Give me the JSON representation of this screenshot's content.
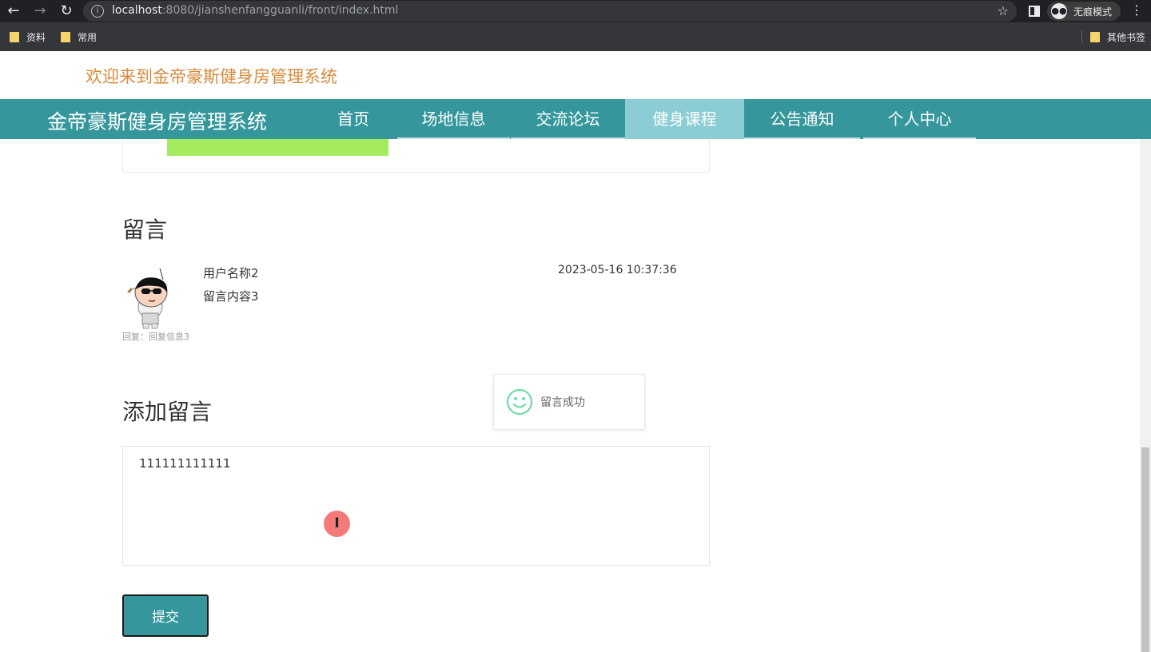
{
  "browser": {
    "back_icon": "arrow-left-icon",
    "forward_icon": "arrow-right-icon",
    "reload_icon": "reload-icon",
    "url_host": "localhost",
    "url_rest": ":8080/jianshenfangguanli/front/index.html",
    "incognito_label": "无痕模式",
    "bookmarks": [
      "资料",
      "常用"
    ],
    "other_bookmarks": "其他书签"
  },
  "header": {
    "welcome": "欢迎来到金帝豪斯健身房管理系统",
    "site_title": "金帝豪斯健身房管理系统"
  },
  "nav": {
    "items": [
      {
        "label": "首页",
        "active": false
      },
      {
        "label": "场地信息",
        "active": false
      },
      {
        "label": "交流论坛",
        "active": false
      },
      {
        "label": "健身课程",
        "active": true
      },
      {
        "label": "公告通知",
        "active": false
      },
      {
        "label": "个人中心",
        "active": false
      }
    ]
  },
  "comments": {
    "heading": "留言",
    "items": [
      {
        "user": "用户名称2",
        "content": "留言内容3",
        "time": "2023-05-16 10:37:36",
        "reply": "回复：回复信息3"
      }
    ]
  },
  "add_comment": {
    "heading": "添加留言",
    "value": "111111111111",
    "submit_label": "提交"
  },
  "toast": {
    "message": "留言成功",
    "icon": "smile-icon"
  },
  "colors": {
    "accent": "#35979c",
    "nav_active": "#8ccdd5",
    "welcome_text": "#d68b3c"
  }
}
